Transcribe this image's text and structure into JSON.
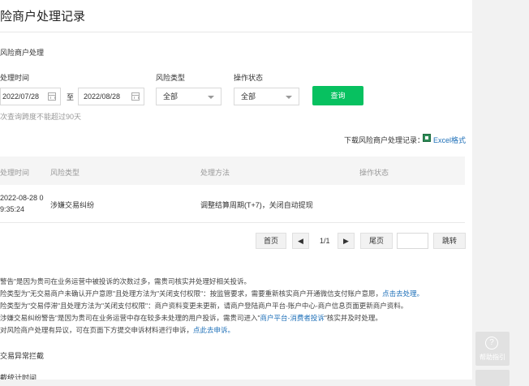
{
  "page": {
    "title": "险商户处理记录"
  },
  "filter": {
    "section_title": "风险商户处理",
    "time_label": "处理时间",
    "date_start": "2022/07/28",
    "separator": "至",
    "date_end": "2022/08/28",
    "risk_type_label": "风险类型",
    "risk_type_value": "全部",
    "status_label": "操作状态",
    "status_value": "全部",
    "query_button": "查询",
    "tip": "次查询跨度不能超过90天"
  },
  "download": {
    "label": "下载风险商户处理记录：",
    "icon": "excel-icon",
    "link": "Excel格式"
  },
  "table": {
    "headers": [
      "处理时间",
      "风险类型",
      "处理方法",
      "操作状态"
    ],
    "rows": [
      {
        "time_line1": "2022-08-28 0",
        "time_line2": "9:35:24",
        "risk_type": "涉嫌交易纠纷",
        "method": "调整结算周期(T+7)，关闭自动提现",
        "status": ""
      }
    ]
  },
  "pagination": {
    "first": "首页",
    "prev_icon": "triangle-left-icon",
    "page": "1/1",
    "next_icon": "triangle-right-icon",
    "last": "尾页",
    "jump": "跳转",
    "input_value": ""
  },
  "notes": {
    "line1": "警告\"是因为贵司在业务运营中被投诉的次数过多，需贵司核实并处理好相关投诉。",
    "line2_a": "险类型为\"无交易商户未确认开户意愿\"且处理方法为\"关闭支付权限\"：按监管要求，需要重新核实商户开通微信支付账户意愿，",
    "line2_link": "点击去处理。",
    "line3": "险类型为\"交易停滞\"且处理方法为\"关闭支付权限\"：商户资料变更未更新，请商户登陆商户平台-账户中心-商户信息页面更新商户资料。",
    "line4_a": "涉嫌交易纠纷警告\"是因为贵司在业务运营中存在较多未处理的用户投诉，需贵司进入\"",
    "line4_link": "商户平台-消费者投诉",
    "line4_b": "\"核实并及时处理。",
    "line5_a": "对风险商户处理有异议，可在页面下方提交申诉材料进行申诉，",
    "line5_link": "点此去申诉。"
  },
  "section2": {
    "title": "交易异常拦截",
    "subtitle": "截统计时间"
  },
  "sidebar": {
    "help_icon": "help-circle-icon",
    "help_label": "帮助指引"
  }
}
